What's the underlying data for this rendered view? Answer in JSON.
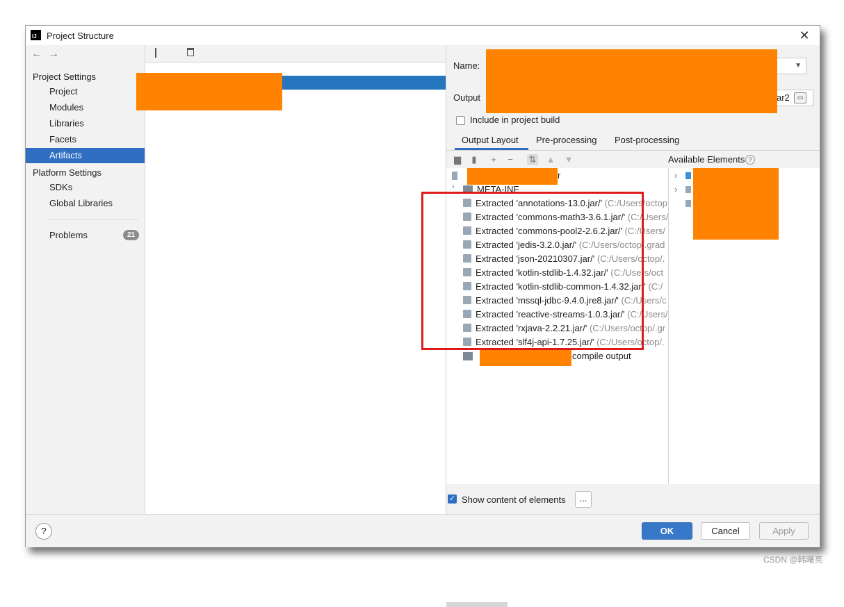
{
  "window": {
    "title": "Project Structure",
    "logo_text": "IJ"
  },
  "nav": {
    "back": "←",
    "forward": "→"
  },
  "sidebar": {
    "project_settings_label": "Project Settings",
    "project_items": [
      {
        "label": "Project"
      },
      {
        "label": "Modules"
      },
      {
        "label": "Libraries"
      },
      {
        "label": "Facets"
      },
      {
        "label": "Artifacts",
        "selected": true
      }
    ],
    "platform_settings_label": "Platform Settings",
    "platform_items": [
      {
        "label": "SDKs"
      },
      {
        "label": "Global Libraries"
      }
    ],
    "problems_label": "Problems",
    "problems_count": "21"
  },
  "artifact_form": {
    "name_label": "Name:",
    "output_label": "Output",
    "output_value_visible": "ar2",
    "include_label": "Include in project build",
    "include_checked": false
  },
  "tabs": [
    {
      "label": "Output Layout",
      "active": true
    },
    {
      "label": "Pre-processing"
    },
    {
      "label": "Post-processing"
    }
  ],
  "available_elements_label": "Available Elements",
  "tree": {
    "root_suffix": "r",
    "meta_inf": "META-INF",
    "extracted": [
      {
        "name": "Extracted 'annotations-13.0.jar/'",
        "path": "(C:/Users/octop"
      },
      {
        "name": "Extracted 'commons-math3-3.6.1.jar/'",
        "path": "(C:/Users/"
      },
      {
        "name": "Extracted 'commons-pool2-2.6.2.jar/'",
        "path": "(C:/Users/"
      },
      {
        "name": "Extracted 'jedis-3.2.0.jar/'",
        "path": "(C:/Users/octop/.grad"
      },
      {
        "name": "Extracted 'json-20210307.jar/'",
        "path": "(C:/Users/octop/."
      },
      {
        "name": "Extracted 'kotlin-stdlib-1.4.32.jar/'",
        "path": "(C:/Users/oct"
      },
      {
        "name": "Extracted 'kotlin-stdlib-common-1.4.32.jar/'",
        "path": "(C:/"
      },
      {
        "name": "Extracted 'mssql-jdbc-9.4.0.jre8.jar/'",
        "path": "(C:/Users/c"
      },
      {
        "name": "Extracted 'reactive-streams-1.0.3.jar/'",
        "path": "(C:/Users/"
      },
      {
        "name": "Extracted 'rxjava-2.2.21.jar/'",
        "path": "(C:/Users/octop/.gr"
      },
      {
        "name": "Extracted 'slf4j-api-1.7.25.jar/'",
        "path": "(C:/Users/octop/."
      }
    ],
    "compile_output_suffix": "compile output"
  },
  "show_content": {
    "label": "Show content of elements",
    "checked": true,
    "more_button": "..."
  },
  "footer": {
    "help": "?",
    "ok": "OK",
    "cancel": "Cancel",
    "apply": "Apply"
  },
  "watermark": "CSDN @韩曙亮",
  "colors": {
    "selection": "#2f6ec1",
    "highlight_box": "#e01a1a",
    "redaction": "#ff8300"
  }
}
